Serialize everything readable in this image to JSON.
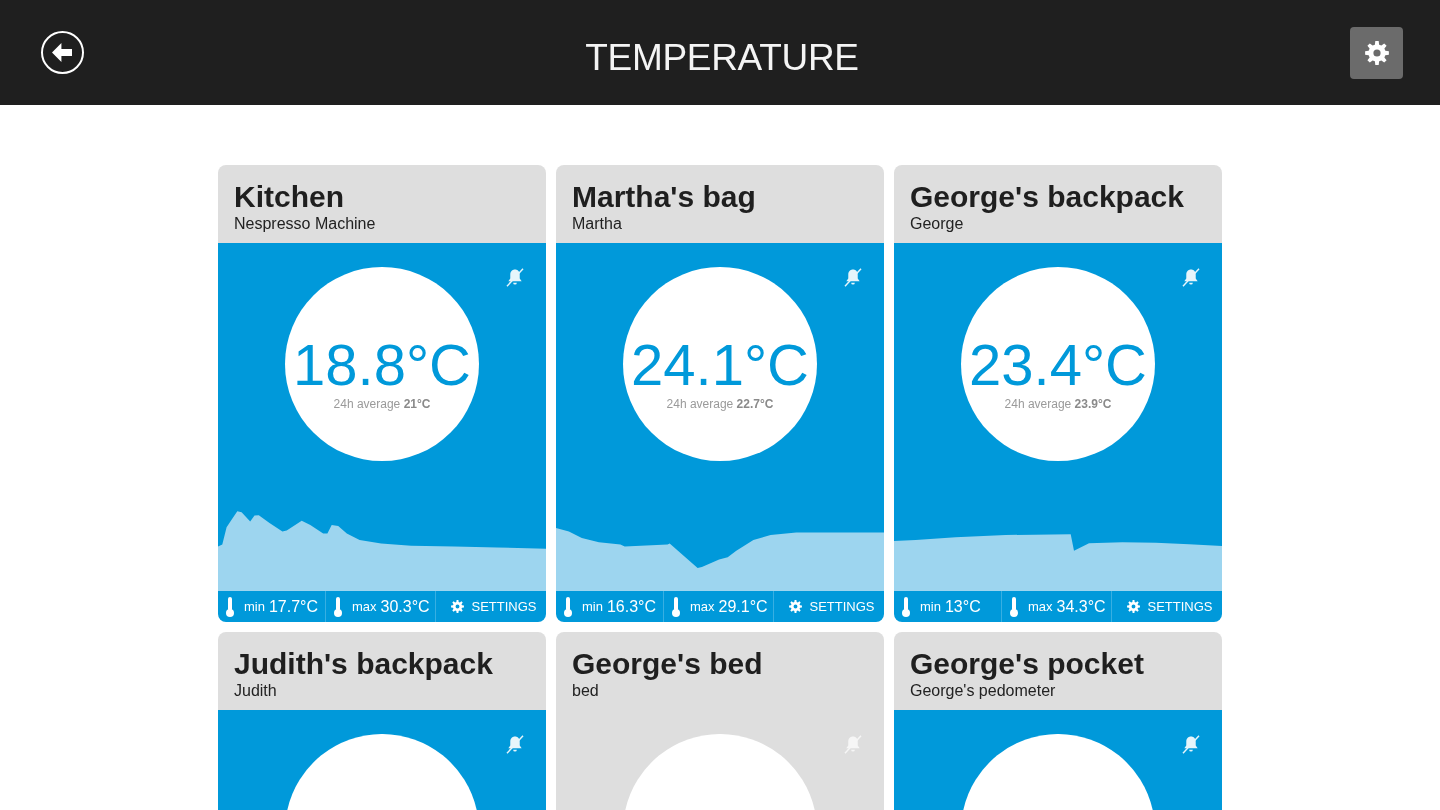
{
  "header": {
    "title": "TEMPERATURE"
  },
  "cards": [
    {
      "title": "Kitchen",
      "subtitle": "Nespresso Machine",
      "active": true,
      "muted": true,
      "reading": {
        "temperature": "18.8°C",
        "average": "24h average **21°C**"
      },
      "footer": {
        "min_label": "min",
        "min": "17.7°C",
        "max_label": "max",
        "max": "30.3°C",
        "settings": "SETTINGS"
      }
    },
    {
      "title": "Martha's bag",
      "subtitle": "Martha",
      "active": true,
      "muted": true,
      "reading": {
        "temperature": "24.1°C",
        "average": "24h average **22.7°C**"
      },
      "footer": {
        "min_label": "min",
        "min": "16.3°C",
        "max_label": "max",
        "max": "29.1°C",
        "settings": "SETTINGS"
      }
    },
    {
      "title": "George's backpack",
      "subtitle": "George",
      "active": true,
      "muted": true,
      "reading": {
        "temperature": "23.4°C",
        "average": "24h average **23.9°C**"
      },
      "footer": {
        "min_label": "min",
        "min": "13°C",
        "max_label": "max",
        "max": "34.3°C",
        "settings": "SETTINGS"
      }
    },
    {
      "title": "Judith's backpack",
      "subtitle": "Judith",
      "active": true,
      "muted": true
    },
    {
      "title": "George's bed",
      "subtitle": "bed",
      "active": false,
      "muted": true
    },
    {
      "title": "George's pocket",
      "subtitle": "George's pedometer",
      "active": true,
      "muted": true
    }
  ]
}
